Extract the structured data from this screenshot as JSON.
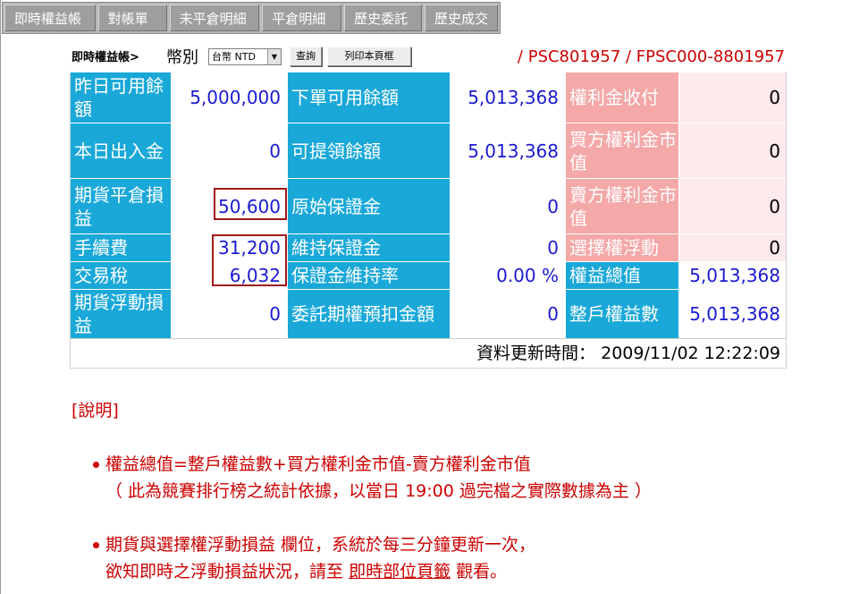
{
  "tabs": [
    "即時權益帳",
    "對帳單",
    "未平倉明細",
    "平倉明細",
    "歷史委託",
    "歷史成交"
  ],
  "header": {
    "title": "即時權益帳>",
    "currency_label": "幣別",
    "currency_selected": "台幣 NTD",
    "query_button": "查詢",
    "print_button": "列印本頁框",
    "accounts": "/ PSC801957 / FPSC000-8801957"
  },
  "table": {
    "rows": [
      {
        "l1": "昨日可用餘額",
        "v1": "5,000,000",
        "l2": "下單可用餘額",
        "v2": "5,013,368",
        "l3": "權利金收付",
        "v3": "0"
      },
      {
        "l1": "本日出入金",
        "v1": "0",
        "l2": "可提領餘額",
        "v2": "5,013,368",
        "l3": "買方權利金市值",
        "v3": "0"
      },
      {
        "l1": "期貨平倉損益",
        "v1": "50,600",
        "l2": "原始保證金",
        "v2": "0",
        "l3": "賣方權利金市值",
        "v3": "0"
      },
      {
        "l1": "手續費",
        "v1": "31,200",
        "l2": "維持保證金",
        "v2": "0",
        "l3": "選擇權浮動",
        "v3": "0"
      },
      {
        "l1": "交易稅",
        "v1": "6,032",
        "l2": "保證金維持率",
        "v2": "0.00 %",
        "l3": "權益總值",
        "v3": "5,013,368"
      },
      {
        "l1": "期貨浮動損益",
        "v1": "0",
        "l2": "委託期權預扣金額",
        "v2": "0",
        "l3": "整戶權益數",
        "v3": "5,013,368"
      }
    ],
    "update_label": "資料更新時間：",
    "update_time": "2009/11/02 12:22:09"
  },
  "notes": {
    "heading": "[說明]",
    "item1_line1": "權益總值=整戶權益數+買方權利金市值-賣方權利金市值",
    "item1_line2": "（ 此為競賽排行榜之統計依據，以當日 19:00 過完檔之實際數據為主 ）",
    "item2_line1": "期貨與選擇權浮動損益 欄位，系統於每三分鐘更新一次，",
    "item2_line2_prefix": "欲知即時之浮動損益狀況，請至",
    "item2_link": "即時部位頁籤",
    "item2_line2_suffix": "觀看。"
  },
  "colors": {
    "label_blue": "#1aa8d8",
    "label_pink": "#f4a8a8",
    "value_pink": "#fdeaea",
    "value_blue_text": "#1a1ad0",
    "note_red": "#cc0000",
    "highlight_box": "#a01818"
  }
}
